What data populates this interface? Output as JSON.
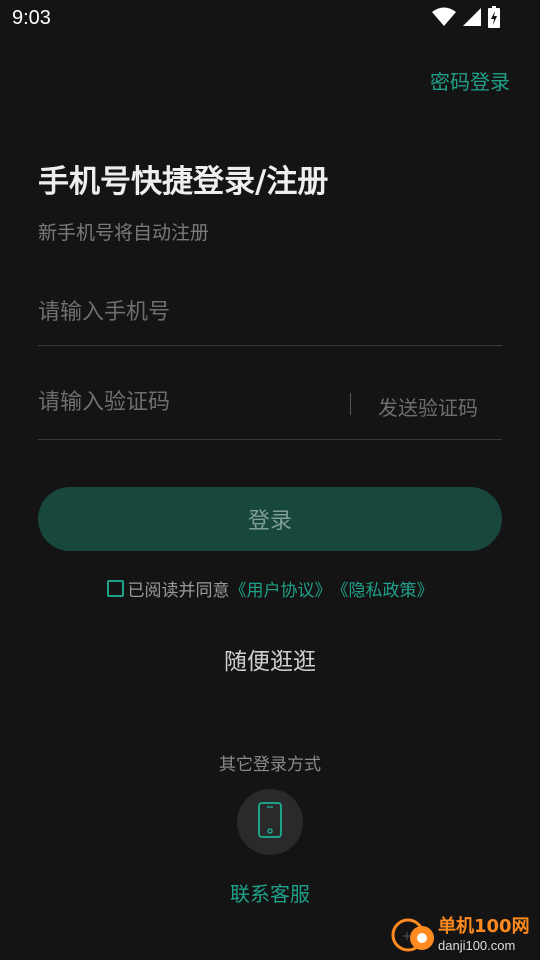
{
  "status_bar": {
    "time": "9:03"
  },
  "header": {
    "password_login": "密码登录"
  },
  "main": {
    "title": "手机号快捷登录/注册",
    "subtitle": "新手机号将自动注册",
    "phone_placeholder": "请输入手机号",
    "code_placeholder": "请输入验证码",
    "send_code": "发送验证码",
    "login_button": "登录",
    "agreement": {
      "prefix": "已阅读并同意",
      "user_agreement": "《用户协议》",
      "privacy_policy": "《隐私政策》"
    },
    "browse": "随便逛逛"
  },
  "other_login": {
    "title": "其它登录方式",
    "icon": "phone-icon"
  },
  "service": "联系客服",
  "watermark": {
    "name": "单机100网",
    "domain": "danji100.com"
  },
  "colors": {
    "background": "#141414",
    "accent": "#1fa088",
    "login_button_bg": "#18483d",
    "watermark_orange": "#ff8a1f"
  }
}
